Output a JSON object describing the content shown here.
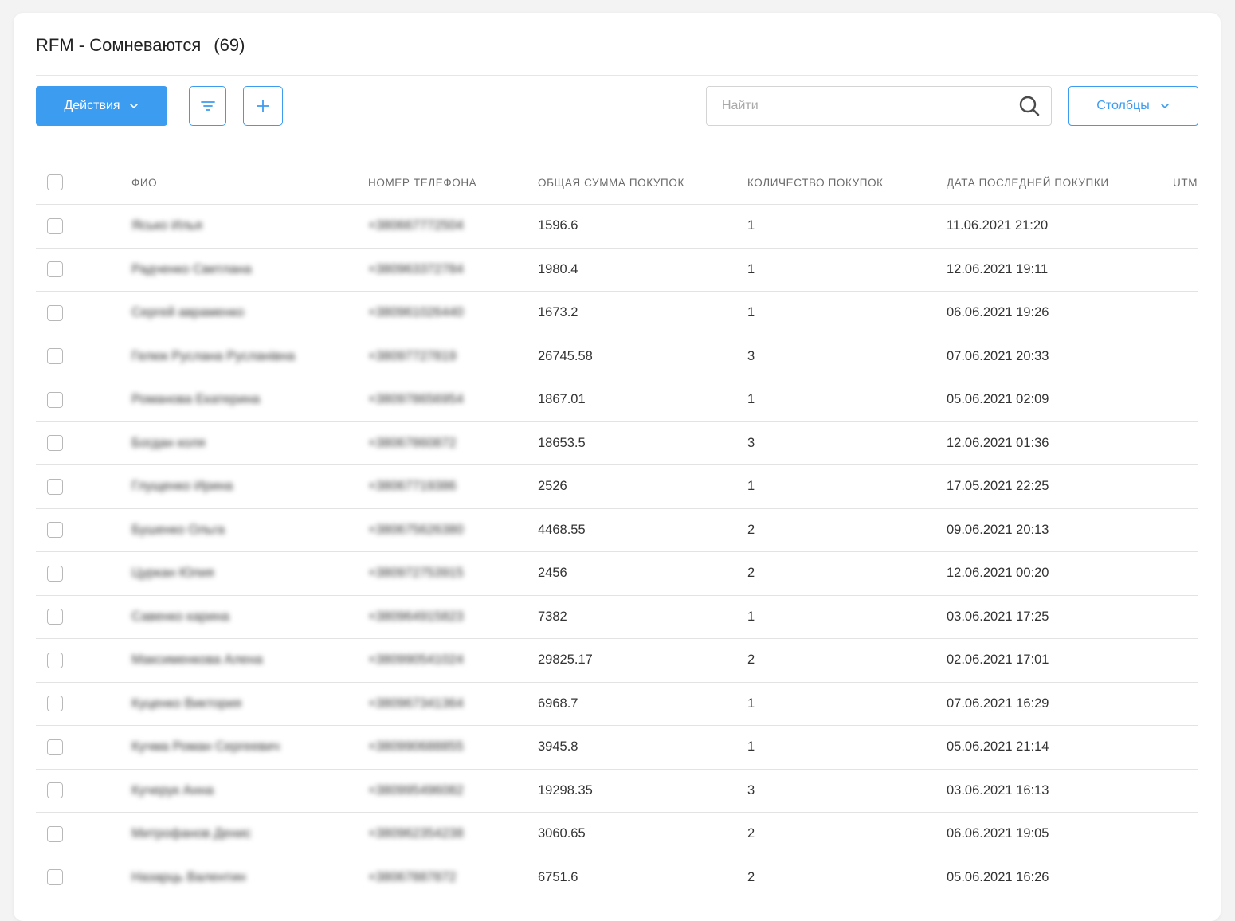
{
  "header": {
    "title": "RFM - Сомневаются",
    "count": "(69)"
  },
  "toolbar": {
    "actions_label": "Действия",
    "search_placeholder": "Найти",
    "columns_label": "Столбцы"
  },
  "table": {
    "columns": [
      "ФИО",
      "НОМЕР ТЕЛЕФОНА",
      "ОБЩАЯ СУММА ПОКУПОК",
      "КОЛИЧЕСТВО ПОКУПОК",
      "ДАТА ПОСЛЕДНЕЙ ПОКУПКИ",
      "UTM"
    ],
    "rows": [
      {
        "name": "Ясько Илья",
        "phone": "+380667772504",
        "sum": "1596.6",
        "qty": "1",
        "date": "11.06.2021 21:20"
      },
      {
        "name": "Радченко Светлана",
        "phone": "+380963372784",
        "sum": "1980.4",
        "qty": "1",
        "date": "12.06.2021 19:11"
      },
      {
        "name": "Сергей авраменко",
        "phone": "+380961026440",
        "sum": "1673.2",
        "qty": "1",
        "date": "06.06.2021 19:26"
      },
      {
        "name": "Гелюк Руслана Русланівна",
        "phone": "+38097727819",
        "sum": "26745.58",
        "qty": "3",
        "date": "07.06.2021 20:33"
      },
      {
        "name": "Романова Екатерина",
        "phone": "+380978656954",
        "sum": "1867.01",
        "qty": "1",
        "date": "05.06.2021 02:09"
      },
      {
        "name": "Богдан коля",
        "phone": "+38067860872",
        "sum": "18653.5",
        "qty": "3",
        "date": "12.06.2021 01:36"
      },
      {
        "name": "Глущенко Ирина",
        "phone": "+38067719386",
        "sum": "2526",
        "qty": "1",
        "date": "17.05.2021 22:25"
      },
      {
        "name": "Бушенко Ольга",
        "phone": "+380675626380",
        "sum": "4468.55",
        "qty": "2",
        "date": "09.06.2021 20:13"
      },
      {
        "name": "Цуркан Юлия",
        "phone": "+380972753915",
        "sum": "2456",
        "qty": "2",
        "date": "12.06.2021 00:20"
      },
      {
        "name": "Савенко карина",
        "phone": "+380964915823",
        "sum": "7382",
        "qty": "1",
        "date": "03.06.2021 17:25"
      },
      {
        "name": "Максименкова Алена",
        "phone": "+380990541024",
        "sum": "29825.17",
        "qty": "2",
        "date": "02.06.2021 17:01"
      },
      {
        "name": "Куценко Виктория",
        "phone": "+380967341364",
        "sum": "6968.7",
        "qty": "1",
        "date": "07.06.2021 16:29"
      },
      {
        "name": "Кучма Роман Сергеевич",
        "phone": "+380990688855",
        "sum": "3945.8",
        "qty": "1",
        "date": "05.06.2021 21:14"
      },
      {
        "name": "Кучерук Анна",
        "phone": "+380995496082",
        "sum": "19298.35",
        "qty": "3",
        "date": "03.06.2021 16:13"
      },
      {
        "name": "Митрофанов Денис",
        "phone": "+380962354238",
        "sum": "3060.65",
        "qty": "2",
        "date": "06.06.2021 19:05"
      },
      {
        "name": "Назарць Валентин",
        "phone": "+38067887872",
        "sum": "6751.6",
        "qty": "2",
        "date": "05.06.2021 16:26"
      }
    ]
  },
  "icons": {
    "actions_chevron": "chevron-down-icon",
    "filter": "filter-icon",
    "add": "plus-icon",
    "search": "search-icon",
    "columns_chevron": "chevron-down-icon"
  },
  "colors": {
    "accent": "#3c9cf0",
    "background": "#f3f3f4",
    "card": "#ffffff",
    "divider": "#e3e3e3"
  }
}
